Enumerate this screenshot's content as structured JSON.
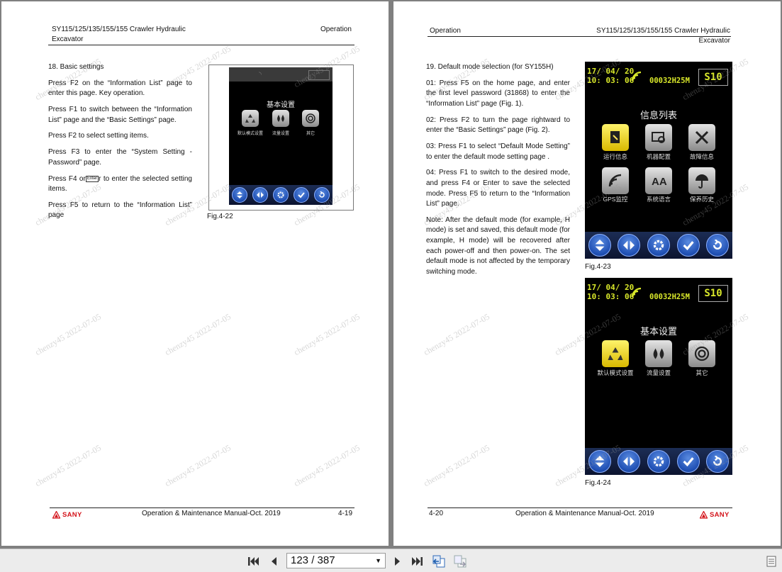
{
  "left_page": {
    "header_title": "SY115/125/135/155/155 Crawler Hydraulic Excavator",
    "header_section": "Operation",
    "heading": "18. Basic settings",
    "paragraphs": [
      "Press F2 on the “Information List” page to enter this page. Key operation.",
      "Press F1 to switch between the “Information List” page and the “Basic Settings” page.",
      "Press F2 to select setting items.",
      "Press F3 to enter the “System Setting - Password” page."
    ],
    "para_f4_before": "Press F4 or",
    "para_f4_key": "Enter",
    "para_f4_after": "r to enter the selected setting items.",
    "para_f5": "Press F5 to return to the “Information List” page",
    "figure_caption": "Fig.4-22",
    "screen_title": "基本设置",
    "screen_items": [
      "默认模式设置",
      "流量设置",
      "其它"
    ],
    "footer_manual": "Operation & Maintenance Manual-Oct. 2019",
    "page_number": "4-19",
    "logo": "SANY"
  },
  "right_page": {
    "header_section": "Operation",
    "header_title": "SY115/125/135/155/155 Crawler Hydraulic Excavator",
    "heading": "19. Default mode selection (for SY155H)",
    "paragraphs": [
      "01: Press F5 on the home page, and enter the first level password (31868) to enter the “Information List” page (Fig. 1).",
      "02: Press F2 to turn the page rightward to enter the “Basic Settings” page (Fig. 2).",
      "03: Press F1 to select “Default Mode Setting” to enter the default mode setting page .",
      "04: Press F1 to switch to the desired mode, and press F4 or Enter to save the selected mode. Press F5 to return to the “Information List” page.",
      "Note: After the default mode (for example, H mode) is set and saved, this default mode (for example, H mode) will be recovered after each power-off and then power-on. The set default mode is not affected by the temporary switching mode."
    ],
    "fig23": {
      "date": "17/ 04/ 20",
      "time": "10: 03: 06",
      "hours": "00032H25M",
      "mode": "S10",
      "title": "信息列表",
      "items": [
        "运行信息",
        "机器配置",
        "故障信息",
        "GPS监控",
        "系统语言",
        "保养历史"
      ],
      "caption": "Fig.4-23"
    },
    "fig24": {
      "date": "17/ 04/ 20",
      "time": "10: 03: 06",
      "hours": "00032H25M",
      "mode": "S10",
      "title": "基本设置",
      "items": [
        "默认模式设置",
        "流量设置",
        "其它"
      ],
      "caption": "Fig.4-24"
    },
    "page_number": "4-20",
    "footer_manual": "Operation & Maintenance Manual-Oct. 2019",
    "logo": "SANY"
  },
  "watermark": "chenzy45 2022-07-05",
  "toolbar": {
    "page_indicator": "123 / 387",
    "icons": [
      "first-page-icon",
      "previous-page-icon",
      "next-page-icon",
      "last-page-icon",
      "previous-view-icon",
      "next-view-icon",
      "document-properties-icon"
    ]
  }
}
